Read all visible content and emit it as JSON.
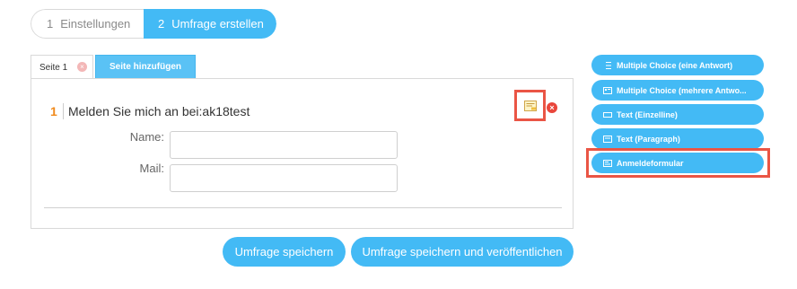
{
  "stepper": {
    "step1": {
      "num": "1",
      "label": "Einstellungen"
    },
    "step2": {
      "num": "2",
      "label": "Umfrage erstellen"
    }
  },
  "tabs": {
    "page_tab": "Seite 1",
    "page_tab_close": "×",
    "add_page": "Seite hinzufügen"
  },
  "question": {
    "number": "1",
    "title": "Melden Sie mich an bei:ak18test",
    "fields": [
      {
        "label": "Name:"
      },
      {
        "label": "Mail:"
      }
    ],
    "delete_glyph": "×"
  },
  "buttons": {
    "save": "Umfrage speichern",
    "save_publish": "Umfrage speichern und veröffentlichen"
  },
  "palette": [
    {
      "label": "Multiple Choice (eine Antwort)",
      "icon": "list-icon"
    },
    {
      "label": "Multiple Choice (mehrere Antwo...",
      "icon": "checkbox-list-icon"
    },
    {
      "label": "Text (Einzelline)",
      "icon": "single-line-text-icon"
    },
    {
      "label": "Text (Paragraph)",
      "icon": "paragraph-text-icon"
    },
    {
      "label": "Anmeldeformular",
      "icon": "form-icon"
    }
  ],
  "colors": {
    "accent": "#43baf5",
    "highlight": "#ea5545",
    "question_number": "#f08a1c"
  }
}
